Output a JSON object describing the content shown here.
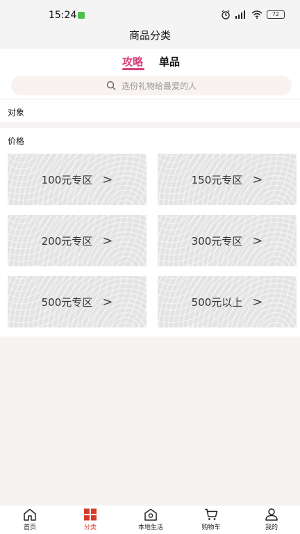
{
  "status": {
    "time": "15:24",
    "battery": "72"
  },
  "header": {
    "title": "商品分类"
  },
  "tabs": [
    {
      "label": "攻略"
    },
    {
      "label": "单品"
    }
  ],
  "search": {
    "placeholder": "选份礼物给最爱的人"
  },
  "sections": {
    "target_label": "对象",
    "price_label": "价格"
  },
  "price_cards": [
    {
      "label": "100元专区"
    },
    {
      "label": "150元专区"
    },
    {
      "label": "200元专区"
    },
    {
      "label": "300元专区"
    },
    {
      "label": "500元专区"
    },
    {
      "label": "500元以上"
    }
  ],
  "chevron": ">",
  "tabbar": [
    {
      "label": "首页",
      "icon": "home-icon"
    },
    {
      "label": "分类",
      "icon": "category-icon"
    },
    {
      "label": "本地生活",
      "icon": "local-life-icon"
    },
    {
      "label": "购物车",
      "icon": "cart-icon"
    },
    {
      "label": "我的",
      "icon": "profile-icon"
    }
  ],
  "colors": {
    "accent": "#d6407b",
    "tabbar_active": "#d63a2a"
  }
}
